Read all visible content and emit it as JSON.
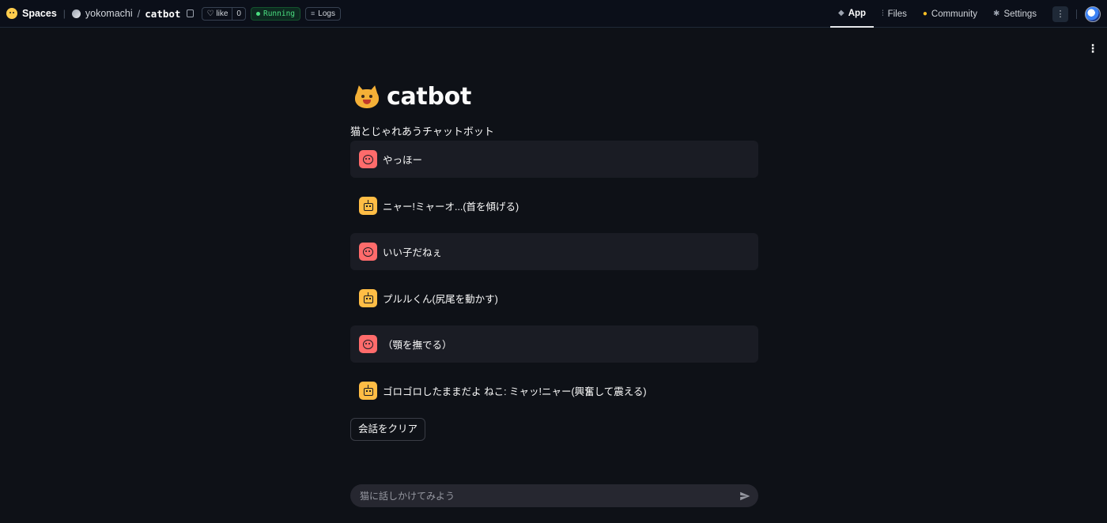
{
  "topbar": {
    "spaces_label": "Spaces",
    "owner": "yokomachi",
    "slash": "/",
    "repo": "catbot",
    "like_label": "like",
    "like_count": "0",
    "status": "Running",
    "logs_label": "Logs",
    "tabs": [
      {
        "label": "App",
        "icon": "cube-icon",
        "active": true
      },
      {
        "label": "Files",
        "icon": "files-icon",
        "active": false
      },
      {
        "label": "Community",
        "icon": "community-icon",
        "active": false
      },
      {
        "label": "Settings",
        "icon": "gear-icon",
        "active": false
      }
    ]
  },
  "app": {
    "title": "catbot",
    "subtitle": "猫とじゃれあうチャットボット",
    "messages": [
      {
        "role": "user",
        "text": "やっほー"
      },
      {
        "role": "assistant",
        "text": "ニャー!ミャーオ...(首を傾げる)"
      },
      {
        "role": "user",
        "text": "いい子だねぇ"
      },
      {
        "role": "assistant",
        "text": "プルルくん(尻尾を動かす)"
      },
      {
        "role": "user",
        "text": "（顎を撫でる）"
      },
      {
        "role": "assistant",
        "text": "ゴロゴロしたままだよ ねこ: ミャッ!ニャー(興奮して震える)"
      }
    ],
    "clear_button": "会話をクリア",
    "input_placeholder": "猫に話しかけてみよう"
  },
  "colors": {
    "background": "#0e1117",
    "user_message_bg": "#1a1c24",
    "user_avatar": "#ff6b6b",
    "bot_avatar": "#ffbd45",
    "running": "#4ade80"
  }
}
